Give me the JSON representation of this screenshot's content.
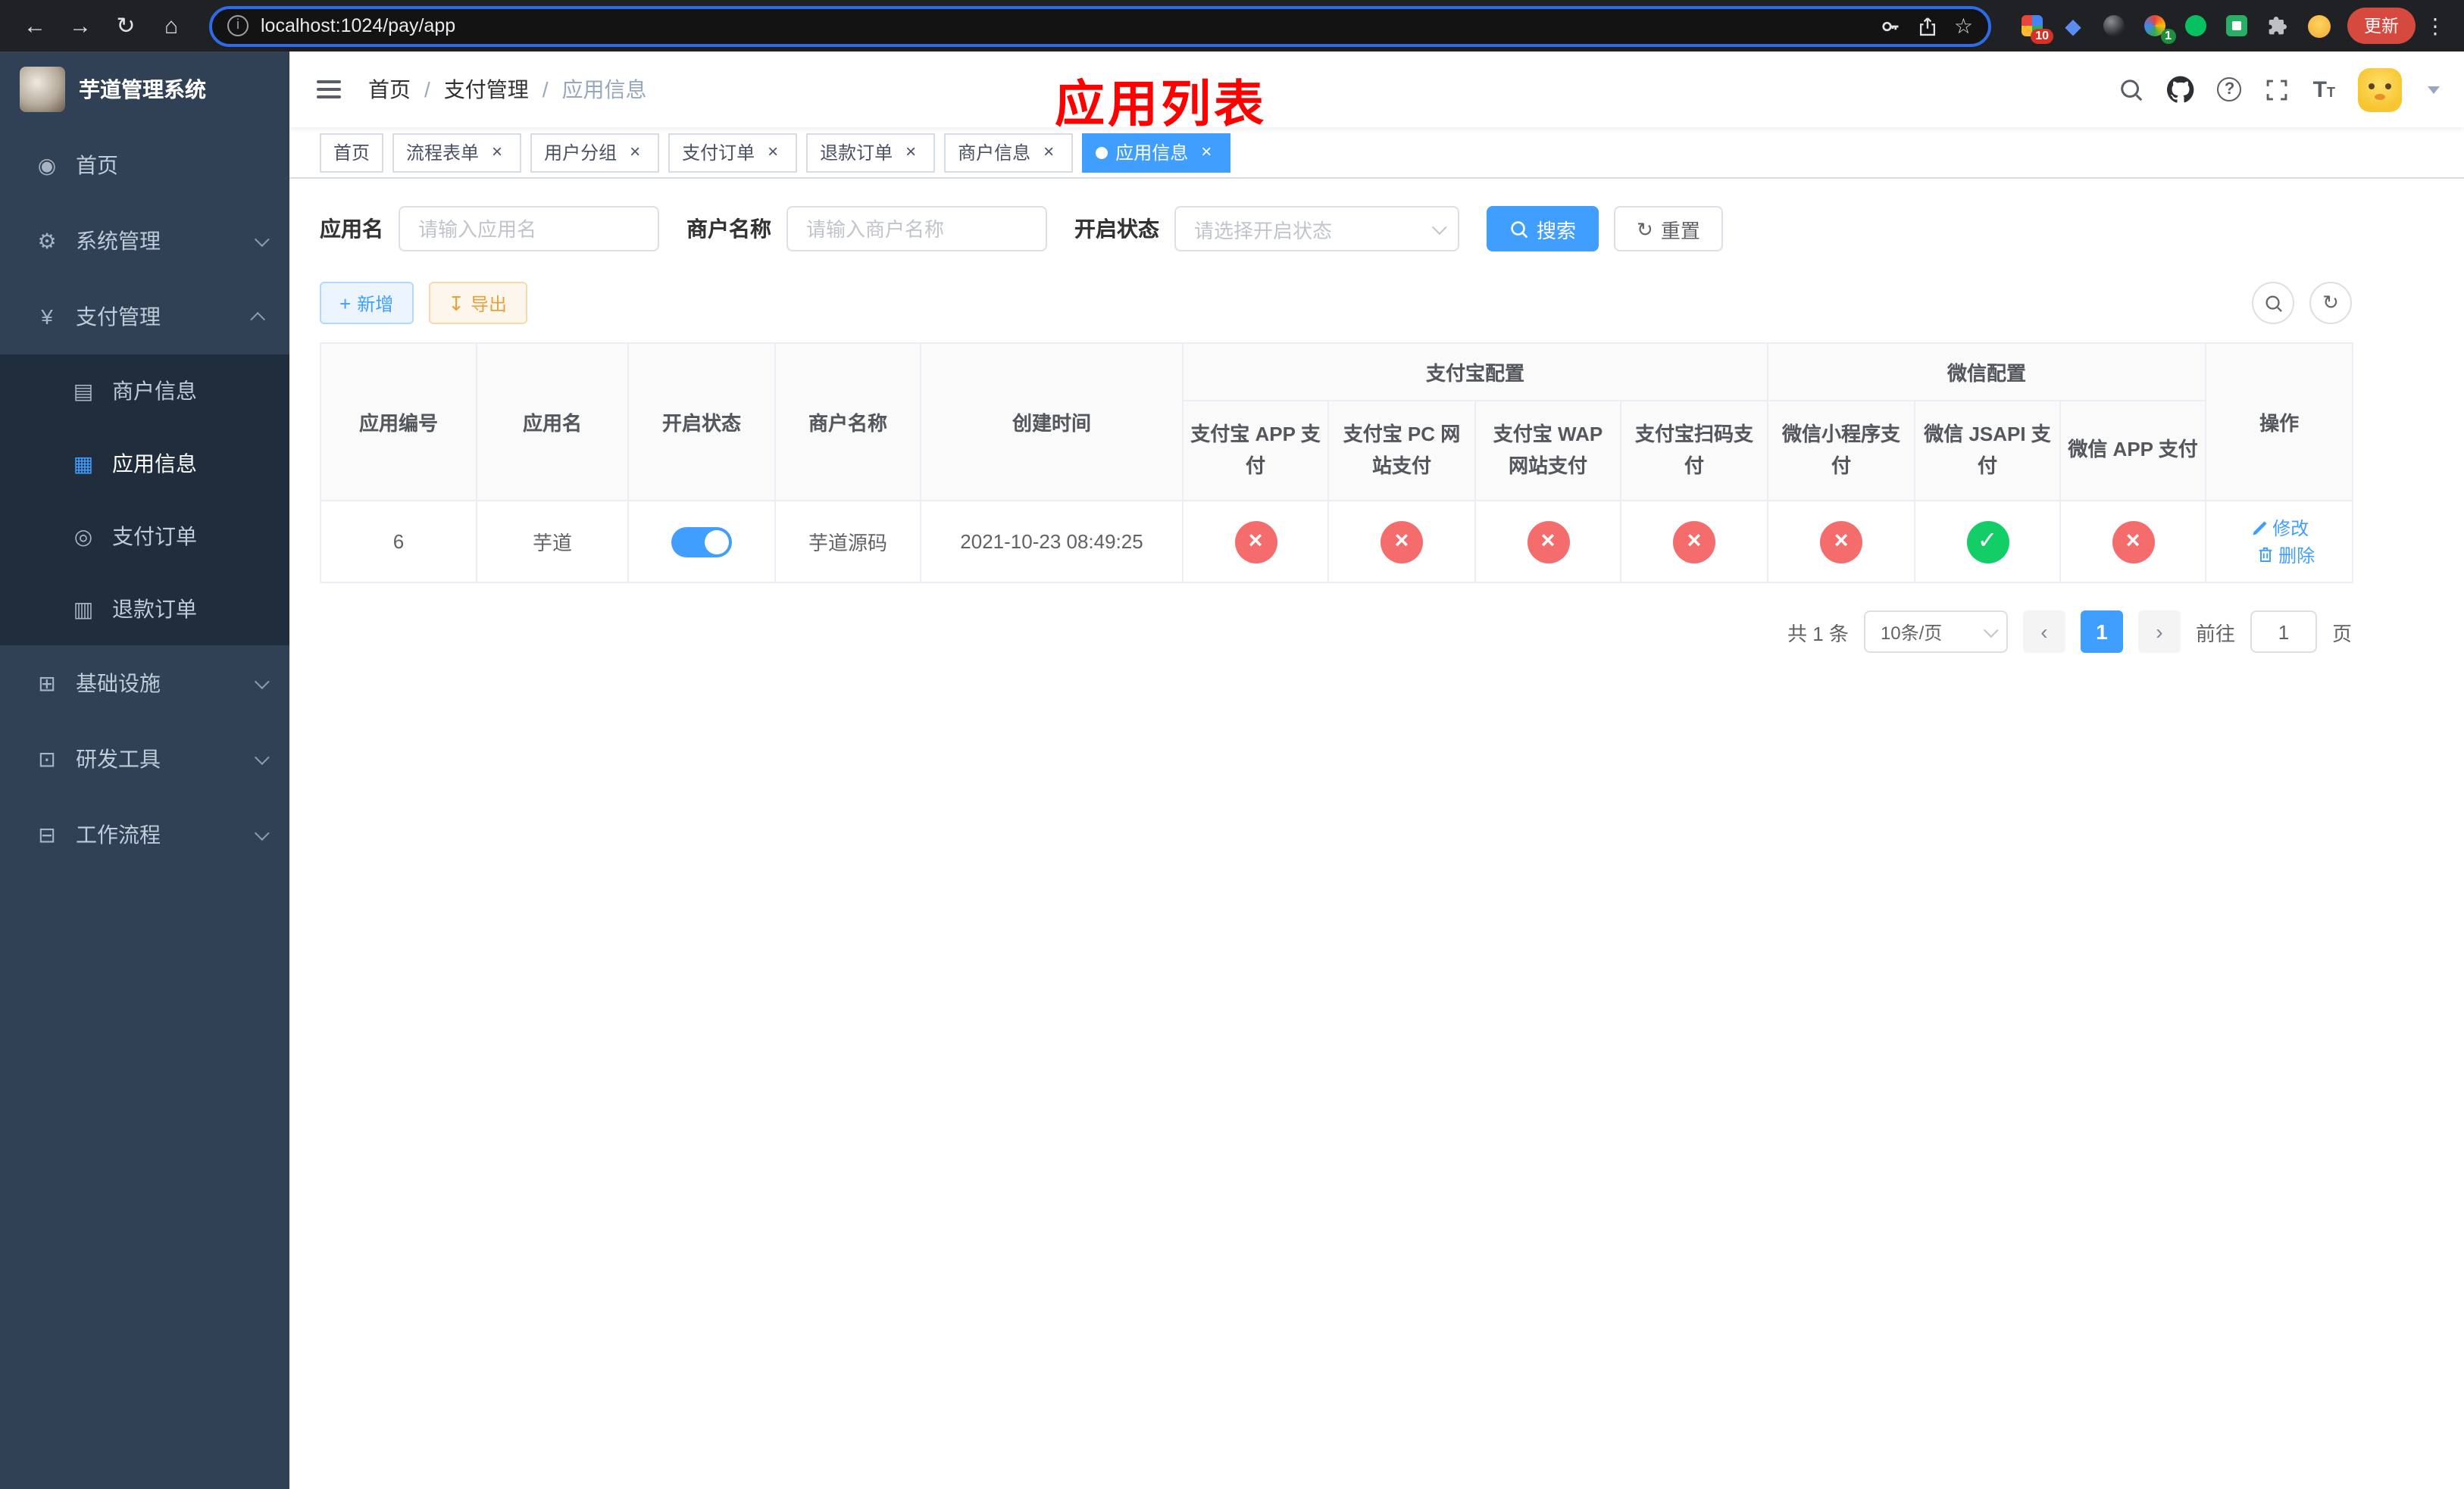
{
  "browser": {
    "url": "localhost:1024/pay/app",
    "update_label": "更新",
    "ext_badge_1": "10",
    "ext_badge_2": "1"
  },
  "sidebar": {
    "title": "芋道管理系统",
    "items": [
      {
        "key": "home",
        "label": "首页",
        "icon": "dashboard-icon",
        "type": "item",
        "expanded": false
      },
      {
        "key": "system",
        "label": "系统管理",
        "icon": "gear-icon",
        "type": "group",
        "expanded": false
      },
      {
        "key": "payment",
        "label": "支付管理",
        "icon": "yen-icon",
        "type": "group",
        "expanded": true,
        "children": [
          {
            "key": "merchant-info",
            "label": "商户信息",
            "icon": "merchant-icon",
            "active": false
          },
          {
            "key": "app-info",
            "label": "应用信息",
            "icon": "app-grid-icon",
            "active": true
          },
          {
            "key": "pay-order",
            "label": "支付订单",
            "icon": "order-icon",
            "active": false
          },
          {
            "key": "refund-order",
            "label": "退款订单",
            "icon": "refund-icon",
            "active": false
          }
        ]
      },
      {
        "key": "infra",
        "label": "基础设施",
        "icon": "infra-icon",
        "type": "group",
        "expanded": false
      },
      {
        "key": "devtools",
        "label": "研发工具",
        "icon": "tools-icon",
        "type": "group",
        "expanded": false
      },
      {
        "key": "workflow",
        "label": "工作流程",
        "icon": "workflow-icon",
        "type": "group",
        "expanded": false
      }
    ]
  },
  "header": {
    "breadcrumb": [
      "首页",
      "支付管理",
      "应用信息"
    ],
    "annotation": "应用列表"
  },
  "tabs": [
    {
      "key": "home",
      "label": "首页",
      "closable": false,
      "active": false
    },
    {
      "key": "flow-form",
      "label": "流程表单",
      "closable": true,
      "active": false
    },
    {
      "key": "user-group",
      "label": "用户分组",
      "closable": true,
      "active": false
    },
    {
      "key": "pay-order",
      "label": "支付订单",
      "closable": true,
      "active": false
    },
    {
      "key": "refund-order",
      "label": "退款订单",
      "closable": true,
      "active": false
    },
    {
      "key": "merchant-info",
      "label": "商户信息",
      "closable": true,
      "active": false
    },
    {
      "key": "app-info",
      "label": "应用信息",
      "closable": true,
      "active": true
    }
  ],
  "filters": {
    "app_name_label": "应用名",
    "app_name_placeholder": "请输入应用名",
    "merchant_label": "商户名称",
    "merchant_placeholder": "请输入商户名称",
    "status_label": "开启状态",
    "status_placeholder": "请选择开启状态",
    "search_label": "搜索",
    "reset_label": "重置"
  },
  "toolbar": {
    "add_label": "新增",
    "export_label": "导出"
  },
  "table": {
    "columns": {
      "app_id": "应用编号",
      "app_name": "应用名",
      "status": "开启状态",
      "merchant": "商户名称",
      "created": "创建时间",
      "ops": "操作",
      "alipay_group": "支付宝配置",
      "wechat_group": "微信配置",
      "pay_cols": [
        "支付宝 APP 支付",
        "支付宝 PC 网站支付",
        "支付宝 WAP 网站支付",
        "支付宝扫码支付",
        "微信小程序支付",
        "微信 JSAPI 支付",
        "微信 APP 支付"
      ]
    },
    "rows": [
      {
        "id": "6",
        "name": "芋道",
        "enabled": true,
        "merchant": "芋道源码",
        "created": "2021-10-23 08:49:25",
        "statuses": [
          false,
          false,
          false,
          false,
          false,
          true,
          false
        ]
      }
    ],
    "edit_label": "修改",
    "delete_label": "删除"
  },
  "pagination": {
    "total_text": "共 1 条",
    "page_size": "10条/页",
    "page": "1",
    "goto_prefix": "前往",
    "goto_value": "1",
    "goto_suffix": "页"
  },
  "colors": {
    "primary": "#409EFF",
    "danger": "#f56c6c",
    "success": "#13ce66",
    "annotation": "#ff0000",
    "sidebar_bg": "#304156",
    "submenu_bg": "#1f2d3d"
  }
}
